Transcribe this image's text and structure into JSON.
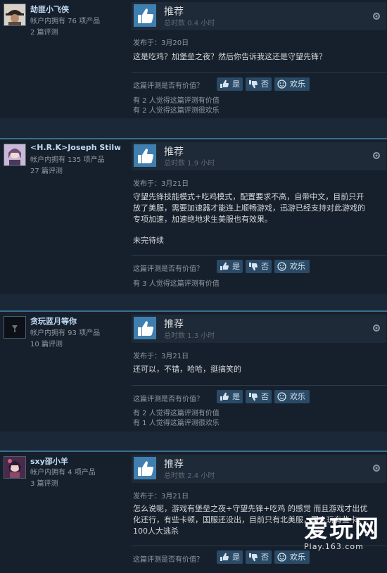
{
  "common": {
    "helpful_question": "这篇评测是否有价值？",
    "yes": "是",
    "no": "否",
    "funny": "欢乐",
    "recommended": "推荐"
  },
  "reviews": [
    {
      "username": "劫匪小飞侠",
      "products": "帐户内拥有 76 项产品",
      "review_count": "2 篇评测",
      "hours": "总时数 0.4 小时",
      "posted": "发布于：3月20日",
      "text": [
        "这是吃鸡？加堡垒之夜？然后你告诉我这还是守望先锋？"
      ],
      "votes": [
        "有 2 人觉得这篇评测有价值",
        "有 2 人觉得这篇评测很欢乐"
      ]
    },
    {
      "username": "<H.R.K>Joseph Stilw...",
      "products": "帐户内拥有 135 项产品",
      "review_count": "27 篇评测",
      "hours": "总时数 1.9 小时",
      "posted": "发布于：3月21日",
      "text": [
        "守望先锋技能模式+吃鸡模式，配置要求不高，自带中文，目前只开",
        "放了美服，需要加速器才能连上顺畅游戏，迅游已经支持对此游戏的",
        "专项加速，加速绝地求生美服也有效果。",
        "",
        "未完待续"
      ],
      "votes": [
        "有 3 人觉得这篇评测有价值"
      ]
    },
    {
      "username": "贪玩蓝月等你",
      "products": "帐户内拥有 93 项产品",
      "review_count": "10 篇评测",
      "hours": "总时数 1.3 小时",
      "posted": "发布于：3月21日",
      "text": [
        "还可以，不错，哈哈，挺搞笑的"
      ],
      "votes": [
        "有 2 人觉得这篇评测有价值",
        "有 1 人觉得这篇评测很欢乐"
      ]
    },
    {
      "username": "sxy邵小羊",
      "products": "帐户内拥有 4 项产品",
      "review_count": "3 篇评测",
      "hours": "总时数 2.4 小时",
      "posted": "发布于：3月21日",
      "text": [
        "怎么说呢，游戏有堡垒之夜+守望先锋+吃鸡 的感觉 而且游戏才出优",
        "化还行，有些卡顿，国服还没出，目前只有北美服，国人玩有些卡，",
        "100人大逃杀"
      ],
      "votes": []
    }
  ],
  "watermark": {
    "logo": "爱玩网",
    "url": "Play.163.com"
  },
  "colors": {
    "accent": "#3a6e8f",
    "thumb": "#3f7fb0",
    "button": "#2a4a66"
  }
}
